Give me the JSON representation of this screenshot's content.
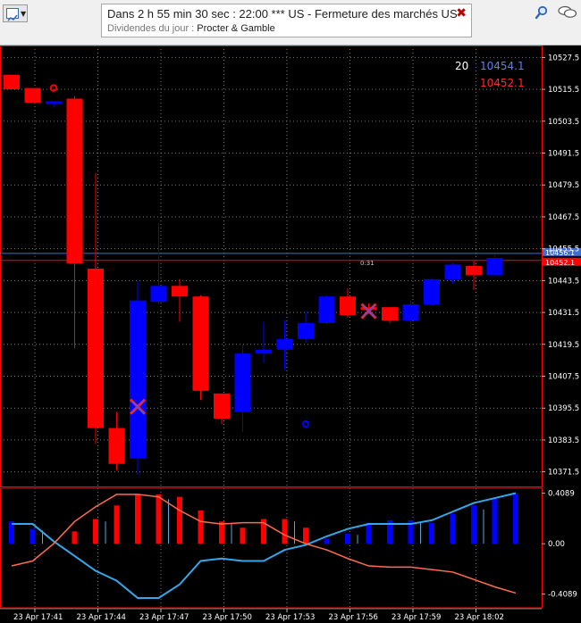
{
  "toolbar": {
    "chart_button_icon": "chart-icon",
    "news": {
      "line1": "Dans 2 h 55 min 30 sec  :  22:00 *** US - Fermeture des marchés US",
      "line2_label": "Dividendes du jour :",
      "line2_value": " Procter & Gamble",
      "close_glyph": "✖"
    },
    "search_icon": "search-icon",
    "chat_icon": "chat-icon"
  },
  "overlay": {
    "period": "20",
    "price_blue": "10454.1",
    "price_red": "10452.1",
    "countdown": "0:31",
    "bid_label": "10456.1",
    "ask_label": "10452.1"
  },
  "colors": {
    "background": "#000000",
    "bull": "#0000ff",
    "bear": "#ff0000",
    "grid": "#7a7a7a",
    "frame": "#ff0000",
    "axis_text": "#ffffff",
    "osc_line_up": "#35a7e8",
    "osc_line_down": "#ff6c4f",
    "bid_line": "#3b6fd6",
    "ask_line": "#ff0000"
  },
  "chart_data": {
    "type": "candlestick",
    "ylim": [
      10366,
      10532
    ],
    "yticks": [
      10527.5,
      10515.5,
      10503.5,
      10491.5,
      10479.5,
      10467.5,
      10455.5,
      10443.5,
      10431.5,
      10419.5,
      10407.5,
      10395.5,
      10383.5,
      10371.5
    ],
    "xticks": [
      "23 Apr 17:41",
      "23 Apr 17:44",
      "23 Apr 17:47",
      "23 Apr 17:50",
      "23 Apr 17:53",
      "23 Apr 17:56",
      "23 Apr 17:59",
      "23 Apr 18:02"
    ],
    "candles": [
      {
        "o": 10521.0,
        "h": 10521.0,
        "l": 10515.5,
        "c": 10515.5
      },
      {
        "o": 10516.0,
        "h": 10516.0,
        "l": 10510.5,
        "c": 10510.5
      },
      {
        "o": 10510.0,
        "h": 10511.0,
        "l": 10508.5,
        "c": 10511.0
      },
      {
        "o": 10512.0,
        "h": 10513.0,
        "l": 10418.0,
        "c": 10450.0
      },
      {
        "o": 10448.0,
        "h": 10484.0,
        "l": 10382.0,
        "c": 10388.0
      },
      {
        "o": 10388.0,
        "h": 10394.0,
        "l": 10372.0,
        "c": 10374.5
      },
      {
        "o": 10376.5,
        "h": 10443.5,
        "l": 10370.5,
        "c": 10436.0
      },
      {
        "o": 10435.5,
        "h": 10465.0,
        "l": 10434.5,
        "c": 10441.5
      },
      {
        "o": 10441.5,
        "h": 10444.0,
        "l": 10428.0,
        "c": 10437.5
      },
      {
        "o": 10437.5,
        "h": 10438.0,
        "l": 10398.5,
        "c": 10402.0
      },
      {
        "o": 10401.0,
        "h": 10401.0,
        "l": 10389.5,
        "c": 10391.5
      },
      {
        "o": 10394.0,
        "h": 10419.5,
        "l": 10386.5,
        "c": 10416.0
      },
      {
        "o": 10416.0,
        "h": 10428.0,
        "l": 10412.5,
        "c": 10417.5
      },
      {
        "o": 10417.5,
        "h": 10428.5,
        "l": 10410.0,
        "c": 10421.5
      },
      {
        "o": 10421.5,
        "h": 10432.0,
        "l": 10420.0,
        "c": 10427.5
      },
      {
        "o": 10427.5,
        "h": 10438.0,
        "l": 10427.0,
        "c": 10437.5
      },
      {
        "o": 10437.5,
        "h": 10440.5,
        "l": 10429.5,
        "c": 10430.5
      },
      {
        "o": 10433.5,
        "h": 10435.0,
        "l": 10431.0,
        "c": 10432.5
      },
      {
        "o": 10433.5,
        "h": 10433.5,
        "l": 10427.5,
        "c": 10428.5
      },
      {
        "o": 10428.5,
        "h": 10436.0,
        "l": 10426.0,
        "c": 10434.5
      },
      {
        "o": 10434.5,
        "h": 10444.5,
        "l": 10434.0,
        "c": 10444.0
      },
      {
        "o": 10444.0,
        "h": 10450.0,
        "l": 10442.5,
        "c": 10449.5
      },
      {
        "o": 10449.0,
        "h": 10451.0,
        "l": 10440.0,
        "c": 10445.5
      },
      {
        "o": 10445.5,
        "h": 10453.0,
        "l": 10445.0,
        "c": 10452.0
      }
    ],
    "markers": [
      {
        "type": "cross",
        "index": 6,
        "price": 10396.0
      },
      {
        "type": "cross",
        "index": 17,
        "price": 10432.0
      },
      {
        "type": "dot",
        "index": 2,
        "price": 10516.0,
        "color": "#ff0000"
      },
      {
        "type": "dot",
        "index": 14,
        "price": 10389.5,
        "color": "#0000ff"
      }
    ],
    "bid": 10454.1,
    "ask": 10452.1,
    "oscillator": {
      "ylim": [
        -0.52,
        0.45
      ],
      "yticks": [
        "0.4089",
        "0.00",
        "-0.4089"
      ],
      "ytick_values": [
        0.4089,
        0.0,
        -0.4089
      ],
      "hist": [
        0.18,
        0.12,
        0.0,
        0.1,
        0.2,
        0.31,
        0.4,
        0.4,
        0.38,
        0.27,
        0.18,
        0.13,
        0.2,
        0.2,
        0.13,
        0.04,
        0.08,
        0.17,
        0.19,
        0.19,
        0.17,
        0.24,
        0.31,
        0.37,
        0.4
      ],
      "line_up": [
        0.16,
        0.16,
        0.02,
        -0.1,
        -0.22,
        -0.3,
        -0.44,
        -0.44,
        -0.33,
        -0.14,
        -0.12,
        -0.14,
        -0.14,
        -0.05,
        -0.01,
        0.06,
        0.12,
        0.16,
        0.16,
        0.16,
        0.19,
        0.26,
        0.33,
        0.37,
        0.41
      ],
      "line_down": [
        -0.18,
        -0.14,
        0.0,
        0.18,
        0.3,
        0.4,
        0.4,
        0.38,
        0.27,
        0.18,
        0.16,
        0.17,
        0.17,
        0.07,
        0.0,
        -0.05,
        -0.12,
        -0.18,
        -0.19,
        -0.19,
        -0.21,
        -0.23,
        -0.29,
        -0.35,
        -0.4
      ]
    }
  }
}
